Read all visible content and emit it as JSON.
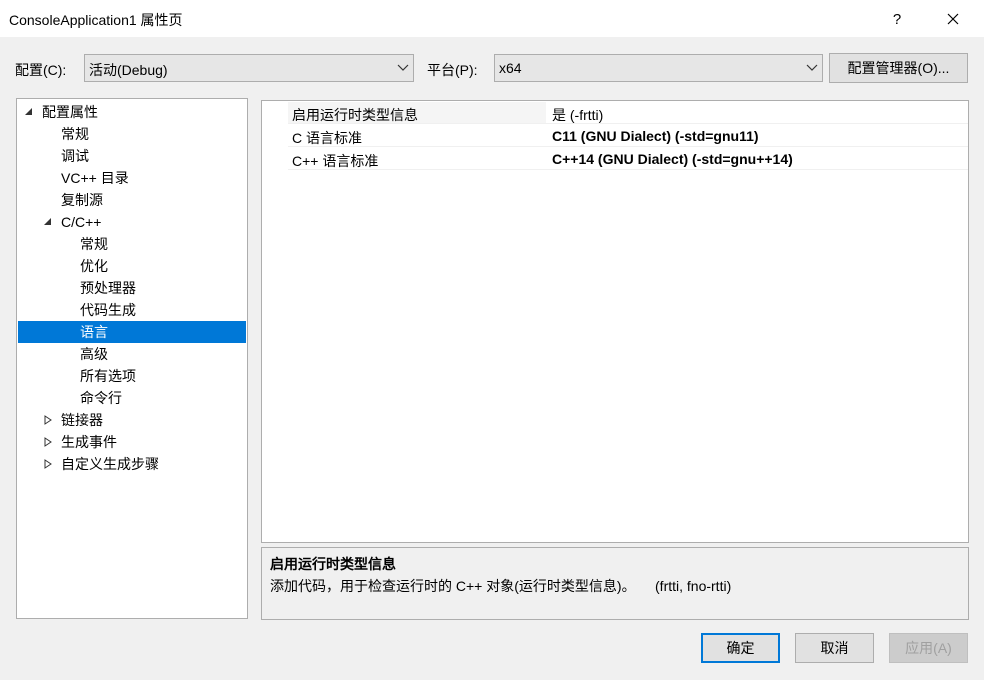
{
  "window": {
    "title": "ConsoleApplication1 属性页",
    "help_glyph": "?",
    "close_icon": "close-icon"
  },
  "toolbar": {
    "config_label": "配置(C):",
    "config_value": "活动(Debug)",
    "platform_label": "平台(P):",
    "platform_value": "x64",
    "config_manager_label": "配置管理器(O)..."
  },
  "tree": {
    "items": [
      {
        "label": "配置属性",
        "expander": "expanded"
      },
      {
        "label": "常规"
      },
      {
        "label": "调试"
      },
      {
        "label": "VC++ 目录"
      },
      {
        "label": "复制源"
      },
      {
        "label": "C/C++",
        "expander": "expanded"
      },
      {
        "label": "常规"
      },
      {
        "label": "优化"
      },
      {
        "label": "预处理器"
      },
      {
        "label": "代码生成"
      },
      {
        "label": "语言",
        "selected": true
      },
      {
        "label": "高级"
      },
      {
        "label": "所有选项"
      },
      {
        "label": "命令行"
      },
      {
        "label": "链接器",
        "expander": "collapsed"
      },
      {
        "label": "生成事件",
        "expander": "collapsed"
      },
      {
        "label": "自定义生成步骤",
        "expander": "collapsed"
      }
    ]
  },
  "grid": {
    "rows": [
      {
        "name": "启用运行时类型信息",
        "value": "是 (-frtti)",
        "bold": false
      },
      {
        "name": "C 语言标准",
        "value": "C11 (GNU Dialect) (-std=gnu11)",
        "bold": true
      },
      {
        "name": "C++ 语言标准",
        "value": "C++14 (GNU Dialect) (-std=gnu++14)",
        "bold": true
      }
    ]
  },
  "description": {
    "title": "启用运行时类型信息",
    "text": "添加代码，用于检查运行时的 C++ 对象(运行时类型信息)。     (frtti, fno-rtti)"
  },
  "buttons": {
    "ok": "确定",
    "cancel": "取消",
    "apply": "应用(A)"
  },
  "colors": {
    "selection": "#0078d7",
    "background": "#f0f0f0"
  }
}
